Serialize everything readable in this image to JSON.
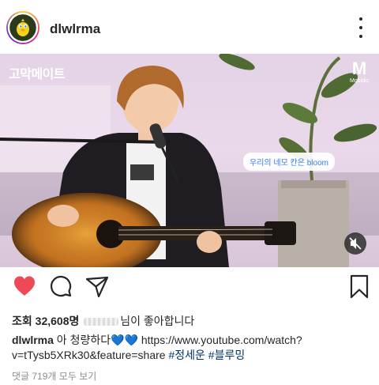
{
  "header": {
    "username": "dlwlrma",
    "avatar_icon": "tweety-avatar-icon",
    "more_icon": "more-options-icon"
  },
  "video": {
    "show_logo": "고막메이트",
    "channel_logo_mark": "M",
    "channel_logo_text": "Mobidic",
    "caption": "우리의 네모 칸은 bloom",
    "mute_icon": "speaker-muted-icon",
    "colors": {
      "caption_text": "#2f7df0",
      "guitar_body": "#c8761f"
    }
  },
  "actions": {
    "like_icon": "heart-filled-icon",
    "comment_icon": "comment-bubble-icon",
    "share_icon": "paper-plane-icon",
    "save_icon": "bookmark-icon",
    "like_color": "#ed4956"
  },
  "likes": {
    "views_label": "조회",
    "views_count": "32,608명",
    "liked_by_suffix": "님이 좋아합니다"
  },
  "caption": {
    "username": "dlwlrma",
    "text": "아 청량하다💙💙 https://www.youtube.com/watch?v=tTysb5XRk30&feature=share",
    "hashtag_1": "#정세운",
    "hashtag_2": "#블루밍"
  },
  "comments": {
    "view_all": "댓글 719개 모두 보기"
  }
}
